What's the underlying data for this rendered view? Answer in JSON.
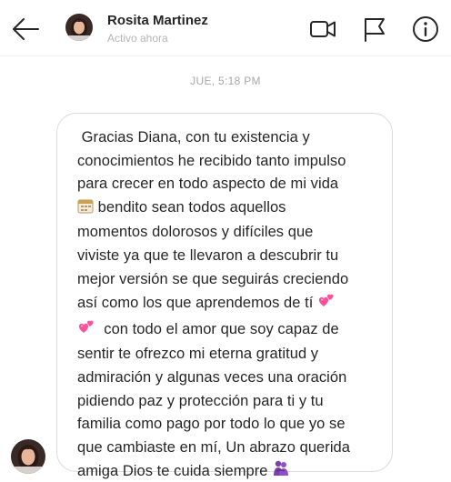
{
  "header": {
    "back_icon": "arrow-left-icon",
    "contact_name": "Rosita Martinez",
    "contact_status": "Activo ahora",
    "actions": [
      "video-call-icon",
      "flag-icon",
      "info-icon"
    ]
  },
  "thread": {
    "timestamp": "JUE, 5:18 PM",
    "message": {
      "line_1": " Gracias Diana, con tu existencia y",
      "line_2": "conocimientos he recibido tanto impulso",
      "line_3": "para crecer en todo aspecto de mi vida",
      "line_4": " bendito sean todos aquellos",
      "line_5": "momentos dolorosos y difíciles que",
      "line_6": "viviste ya que te llevaron a descubrir tu",
      "line_7": "mejor versión se que seguirás creciendo",
      "line_8": "así como los que aprendemos de tí ",
      "line_9": "  con todo el amor que soy capaz de",
      "line_10": "sentir te ofrezco mi eterna gratitud y",
      "line_11": "admiración y algunas veces una oración",
      "line_12": "pidiendo paz y protección para ti y tu",
      "line_13": "familia como pago por todo lo que yo se",
      "line_14": "que cambiaste en mí, Un abrazo querida",
      "line_15": "amiga Dios te cuida siempre ",
      "emojis": [
        "calendar-emoji",
        "two-hearts-emoji",
        "two-hearts-emoji",
        "people-hugging-emoji"
      ]
    }
  },
  "colors": {
    "text": "#262626",
    "muted": "#a8a8a8",
    "bubble_border": "#dbdbdb",
    "heart": "#ff4f9a",
    "hug": "#7b3fb0"
  }
}
